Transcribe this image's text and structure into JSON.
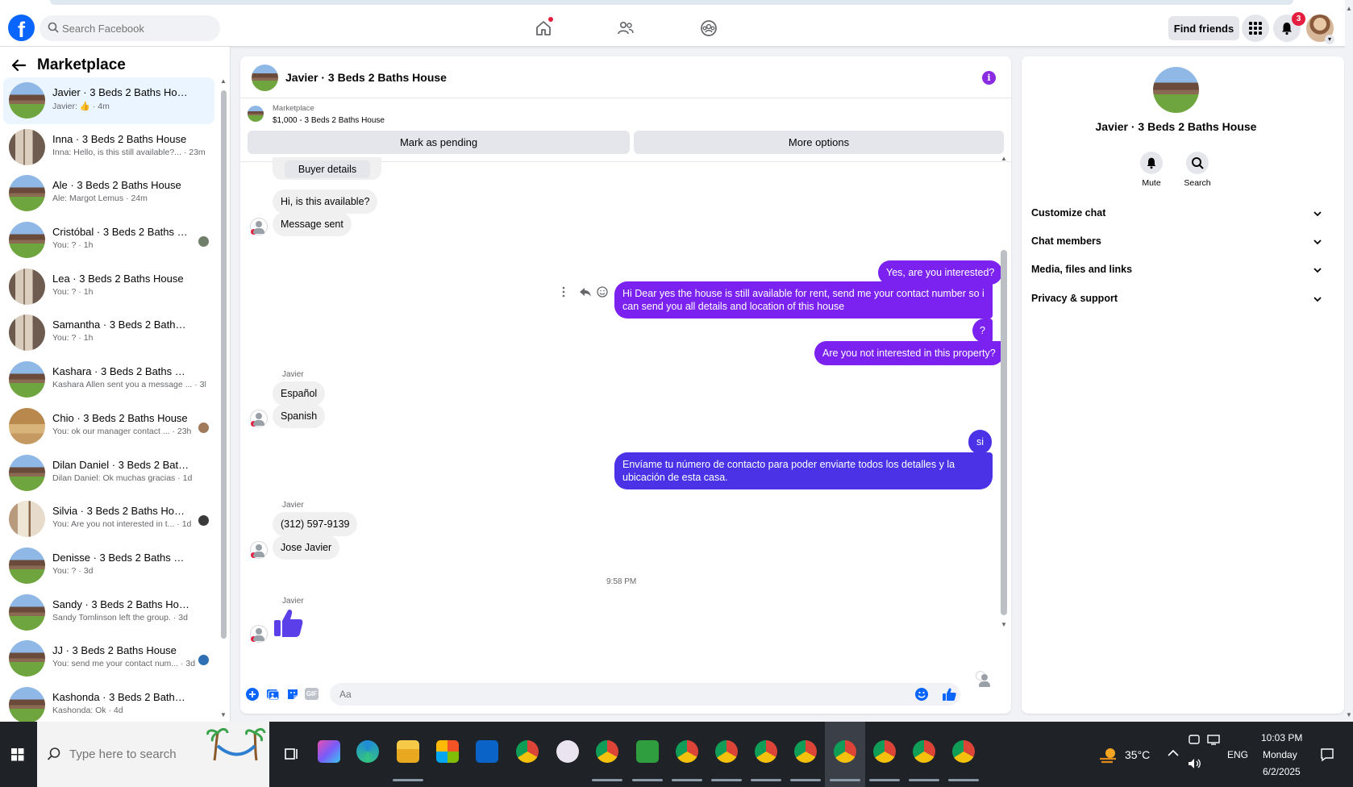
{
  "topnav": {
    "logo": "f",
    "search_placeholder": "Search Facebook",
    "find_friends": "Find friends",
    "notifications_count": "3"
  },
  "sidebar": {
    "title": "Marketplace",
    "conversations": [
      {
        "name": "Javier · 3 Beds 2 Baths House",
        "preview": "Javier: 👍 · 4m"
      },
      {
        "name": "Inna · 3 Beds 2 Baths House",
        "preview": "Inna: Hello, is this still available?... · 23m"
      },
      {
        "name": "Ale · 3 Beds 2 Baths House",
        "preview": "Ale: Margot Lemus · 24m"
      },
      {
        "name": "Cristóbal · 3 Beds 2 Baths Ho...",
        "preview": "You: ? · 1h"
      },
      {
        "name": "Lea · 3 Beds 2 Baths House",
        "preview": "You: ? · 1h"
      },
      {
        "name": "Samantha · 3 Beds 2 Baths House",
        "preview": "You: ? · 1h"
      },
      {
        "name": "Kashara · 3 Beds 2 Baths House",
        "preview": "Kashara Allen sent you a message ... · 3h"
      },
      {
        "name": "Chio · 3 Beds 2 Baths House",
        "preview": "You: ok our manager contact ... · 23h"
      },
      {
        "name": "Dilan Daniel · 3 Beds 2 Baths H...",
        "preview": "Dilan Daniel: Ok muchas gracias · 1d"
      },
      {
        "name": "Silvia · 3 Beds 2 Baths House",
        "preview": "You: Are you not interested in t... · 1d"
      },
      {
        "name": "Denisse · 3 Beds 2 Baths House",
        "preview": "You: ? · 3d"
      },
      {
        "name": "Sandy · 3 Beds 2 Baths House",
        "preview": "Sandy Tomlinson left the group. · 3d"
      },
      {
        "name": "JJ · 3 Beds 2 Baths House",
        "preview": "You: send me your contact num... · 3d"
      },
      {
        "name": "Kashonda · 3 Beds 2 Baths House",
        "preview": "Kashonda: Ok · 4d"
      }
    ]
  },
  "chat": {
    "title": "Javier · 3 Beds 2 Baths House",
    "marketplace_label": "Marketplace",
    "listing": "$1,000 - 3 Beds 2 Baths House",
    "mark_pending": "Mark as pending",
    "more_options": "More options",
    "buyer_details": "Buyer details",
    "messages": {
      "m1": "Hi, is this available?",
      "m2": "Message sent",
      "m3": "Yes, are you interested?",
      "m4": "Hi Dear yes the house is still available for rent, send me your contact number so i can send you all details and location of this house",
      "m5": "?",
      "m6": "Are you not interested in this property?",
      "sender": "Javier",
      "m7": "Español",
      "m8": "Spanish",
      "m9": "si",
      "m10": "Envíame tu número de contacto para poder enviarte todos los detalles y la ubicación de esta casa.",
      "m11": "(312) 597-9139",
      "m12": "Jose Javier",
      "time": "9:58 PM"
    },
    "composer_placeholder": "Aa",
    "gif_label": "GIF"
  },
  "info_panel": {
    "name": "Javier · 3 Beds 2 Baths House",
    "mute": "Mute",
    "search": "Search",
    "rows": [
      "Customize chat",
      "Chat members",
      "Media, files and links",
      "Privacy & support"
    ]
  },
  "taskbar": {
    "search_placeholder": "Type here to search",
    "temperature": "35°C",
    "language": "ENG",
    "time": "10:03 PM",
    "day": "Monday",
    "date": "6/2/2025"
  },
  "colors": {
    "fb_blue": "#0866ff",
    "outgoing_purple": "#7b22f0",
    "outgoing_blue": "#4b32e6",
    "badge_red": "#e41e3f"
  }
}
